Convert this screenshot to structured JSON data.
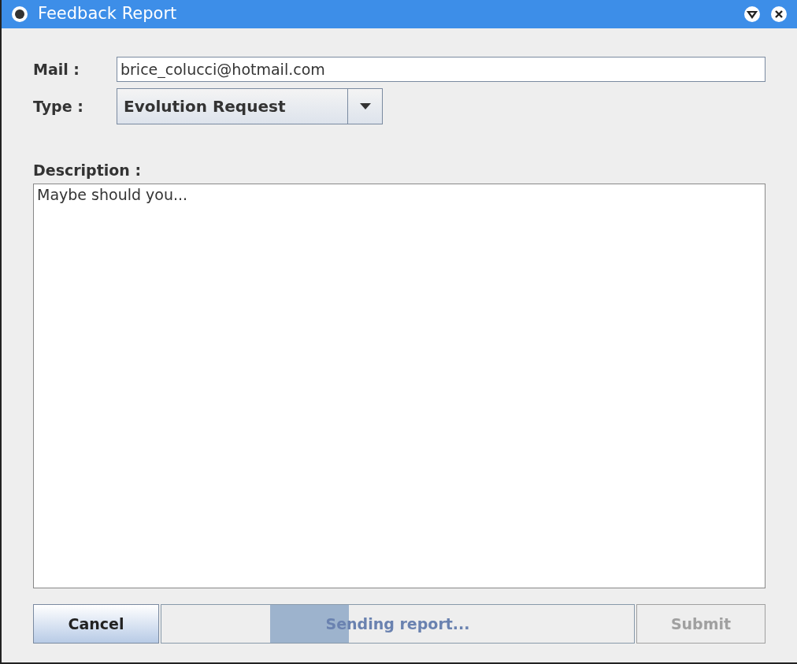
{
  "window": {
    "title": "Feedback Report"
  },
  "mail": {
    "label": "Mail :",
    "value": "brice_colucci@hotmail.com",
    "focused": true
  },
  "type": {
    "label": "Type :",
    "value": "Evolution Request"
  },
  "description": {
    "label": "Description :",
    "value": "Maybe should you..."
  },
  "cancel": {
    "label": "Cancel",
    "disabled": false
  },
  "progress": {
    "label": "Sending report...",
    "indeterminate": true
  },
  "submit": {
    "label": "Submit",
    "disabled": true
  }
}
